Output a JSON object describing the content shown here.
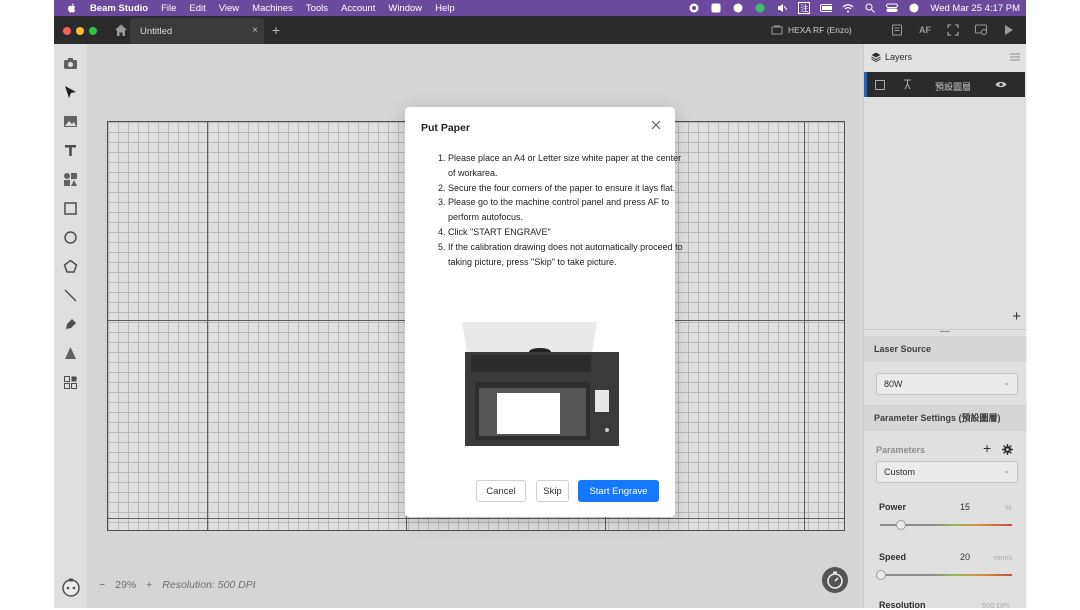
{
  "menubar": {
    "app_name": "Beam Studio",
    "items": [
      "File",
      "Edit",
      "View",
      "Machines",
      "Tools",
      "Account",
      "Window",
      "Help"
    ],
    "clock": "Wed Mar 25  4:17 PM",
    "input_method": "注"
  },
  "titlebar": {
    "tab_title": "Untitled",
    "tab_close": "×",
    "add_tab": "+",
    "machine_name": "HEXA RF (Enzo)",
    "af_label": "AF"
  },
  "canvas": {
    "zoom_minus": "−",
    "zoom_level": "29%",
    "zoom_plus": "+",
    "resolution": "Resolution: 500 DPI"
  },
  "right_panel": {
    "layers_title": "Layers",
    "layer_name": "預設圖層",
    "add_layer": "+",
    "laser_source_title": "Laser Source",
    "laser_source_value": "80W",
    "parameter_settings_title": "Parameter Settings (預設圖層)",
    "parameters_label": "Parameters",
    "preset_value": "Custom",
    "power_label": "Power",
    "power_value": "15",
    "power_unit": "%",
    "power_fraction": 0.15,
    "speed_label": "Speed",
    "speed_value": "20",
    "speed_unit": "mm/s",
    "speed_fraction": 0.0,
    "resolution_label": "Resolution",
    "resolution_value": "500 DPI"
  },
  "modal": {
    "title": "Put Paper",
    "steps": [
      "Please place an A4 or Letter size white paper at the center of workarea.",
      "Secure the four corners of the paper to ensure it lays flat.",
      "Please go to the machine control panel and press AF to perform autofocus.",
      "Click \"START ENGRAVE\"",
      "If the calibration drawing does not automatically proceed to taking picture, press \"Skip\" to take picture."
    ],
    "cancel_label": "Cancel",
    "skip_label": "Skip",
    "start_label": "Start Engrave"
  },
  "colors": {
    "menubar": "#6b4a9e",
    "titlebar": "#2b2b2b",
    "primary": "#1677ff",
    "layer_accent": "#1f6fd6"
  }
}
